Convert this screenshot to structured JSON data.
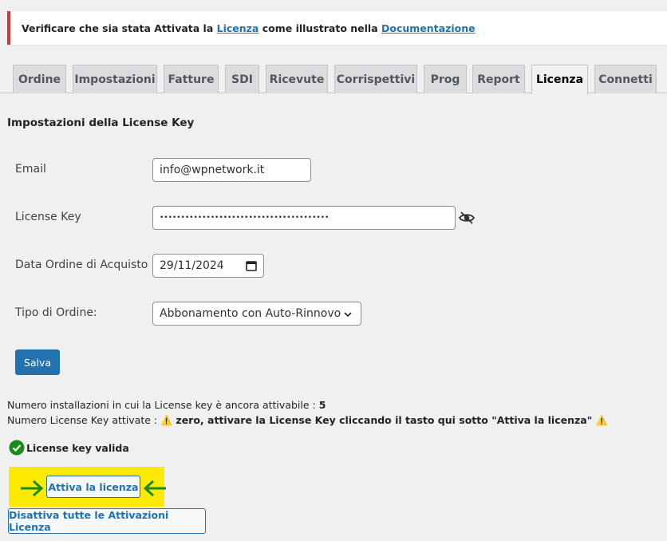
{
  "notice": {
    "prefix": "Verificare che sia stata Attivata la ",
    "link1": "Licenza",
    "middle": " come illustrato nella ",
    "link2": "Documentazione"
  },
  "tabs": [
    {
      "label": "Ordine"
    },
    {
      "label": "Impostazioni"
    },
    {
      "label": "Fatture"
    },
    {
      "label": "SDI"
    },
    {
      "label": "Ricevute"
    },
    {
      "label": "Corrispettivi"
    },
    {
      "label": "Prog"
    },
    {
      "label": "Report"
    },
    {
      "label": "Licenza",
      "active": true
    },
    {
      "label": "Connetti"
    }
  ],
  "section_title": "Impostazioni della License Key",
  "form": {
    "email_label": "Email",
    "email_value": "info@wpnetwork.it",
    "license_label": "License Key",
    "license_value": "••••••••••••••••••••••••••••••••••••••••",
    "date_label": "Data Ordine di Acquisto",
    "date_value": "29/11/2024",
    "order_type_label": "Tipo di Ordine:",
    "order_type_value": "Abbonamento con Auto-Rinnovo",
    "save_label": "Salva"
  },
  "info": {
    "installations_text": "Numero installazioni in cui la License key è ancora attivabile : ",
    "installations_count": "5",
    "activated_text": "Numero License Key attivate : ",
    "activated_warning": " zero, attivare la License Key cliccando il tasto qui sotto \"Attiva la licenza\" ",
    "warning_glyph": "⚠️"
  },
  "status": {
    "valid_text": "License key valida",
    "color": "#1a8b1a"
  },
  "actions": {
    "activate_label": "Attiva la licenza",
    "deactivate_label": "Disattiva tutte le Attivazioni Licenza"
  },
  "colors": {
    "accent": "#2271b1",
    "highlight": "#fcea00",
    "arrow": "#1a8b1a",
    "notice_border": "#d63638"
  }
}
